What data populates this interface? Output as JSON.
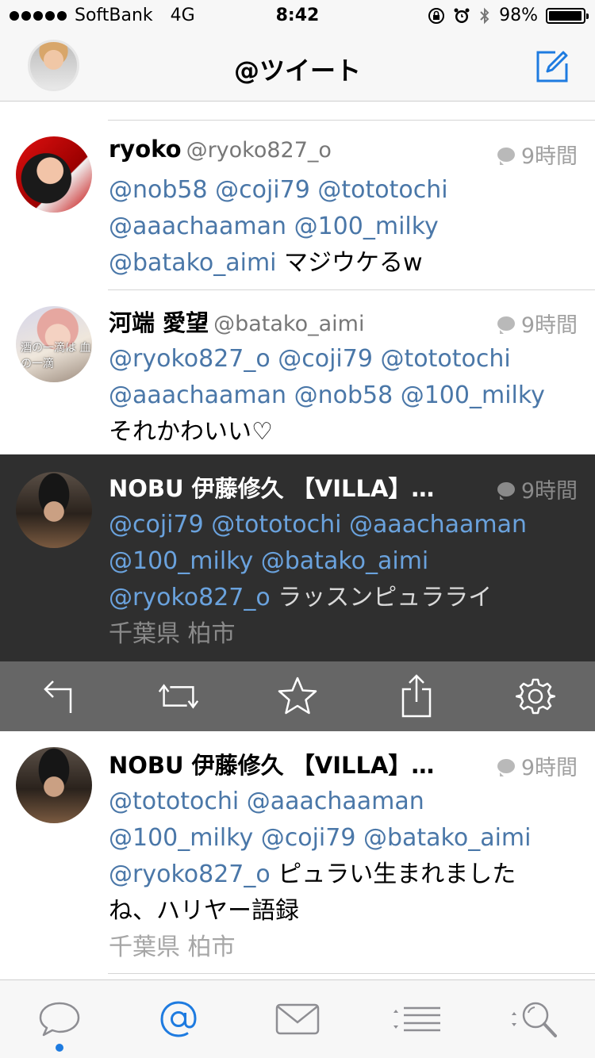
{
  "status_bar": {
    "carrier": "SoftBank",
    "network": "4G",
    "time": "8:42",
    "battery_percent": "98%",
    "battery_level": 0.98
  },
  "nav": {
    "title": "@ツイート"
  },
  "tweets": [
    {
      "name": "ryoko",
      "handle": "@ryoko827_o",
      "time": "9時間",
      "mentions_1": "@nob58 @coji79 @tototochi",
      "mentions_2": "@aaachaaman @100_milky",
      "mentions_3": "@batako_aimi",
      "text_3": " マジウケるw"
    },
    {
      "name": "河端 愛望",
      "handle": "@batako_aimi",
      "time": "9時間",
      "avatar_text": "酒の一滴は 血の一滴",
      "mentions_1": "@ryoko827_o @coji79 @tototochi",
      "mentions_2": "@aaachaaman @nob58 @100_milky",
      "text_3": "それかわいい♡"
    },
    {
      "name": "NOBU  伊藤修久 【VILLA】…",
      "time": "9時間",
      "mentions_1": "@coji79 @tototochi @aaachaaman",
      "mentions_2": "@100_milky @batako_aimi",
      "mentions_3": "@ryoko827_o",
      "text_3": " ラッスンピュラライ",
      "location": "千葉県 柏市"
    },
    {
      "name": "NOBU  伊藤修久 【VILLA】…",
      "time": "9時間",
      "mentions_1": "@tototochi @aaachaaman",
      "mentions_2": "@100_milky @coji79 @batako_aimi",
      "mentions_3": "@ryoko827_o",
      "text_3": " ピュラい生まれました",
      "text_4": "ね、ハリヤー語録",
      "location": "千葉県 柏市"
    }
  ],
  "actions": [
    "reply-icon",
    "retweet-icon",
    "favorite-icon",
    "share-icon",
    "settings-icon"
  ],
  "tabs": [
    "timeline-icon",
    "mentions-icon",
    "messages-icon",
    "lists-icon",
    "search-icon"
  ],
  "colors": {
    "accent": "#1e7be0",
    "mention": "#4a77a8",
    "selected_bg": "#2f2f2f",
    "action_bar": "#666666"
  }
}
